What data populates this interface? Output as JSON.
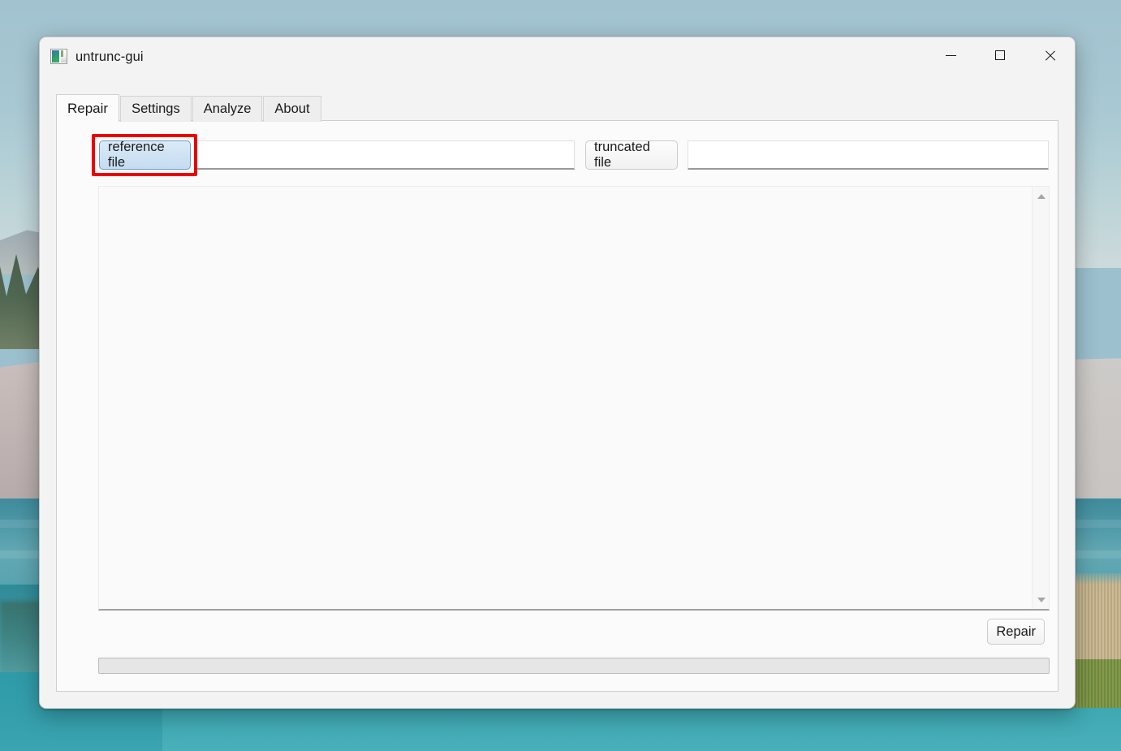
{
  "window": {
    "title": "untrunc-gui",
    "icon": "app-image-icon",
    "controls": {
      "minimize": "minimize-icon",
      "maximize": "maximize-icon",
      "close": "close-icon"
    }
  },
  "tabs": [
    {
      "label": "Repair",
      "active": true
    },
    {
      "label": "Settings",
      "active": false
    },
    {
      "label": "Analyze",
      "active": false
    },
    {
      "label": "About",
      "active": false
    }
  ],
  "repair_tab": {
    "reference": {
      "button_label": "reference file",
      "field_value": "",
      "field_placeholder": ""
    },
    "truncated": {
      "button_label": "truncated file",
      "field_value": "",
      "field_placeholder": ""
    },
    "log": {
      "content": "",
      "scrollbar": {
        "up_arrow": "scroll-up-icon",
        "down_arrow": "scroll-down-icon"
      }
    },
    "action_button": "Repair",
    "progress": {
      "value": 0,
      "max": 100,
      "text": ""
    }
  },
  "annotation": {
    "highlight_color": "#ee0000",
    "target": "reference file"
  },
  "colors": {
    "window_bg": "#f3f3f3",
    "panel_bg": "#fbfbfb",
    "active_tab_bg": "#fbfbfb",
    "inactive_tab_bg": "#eeeeee",
    "highlight_button_bg": "#cfe3f4",
    "highlight_button_border": "#6b9fd0",
    "annotation_red": "#ee0000",
    "progress_track": "#e6e6e6"
  }
}
